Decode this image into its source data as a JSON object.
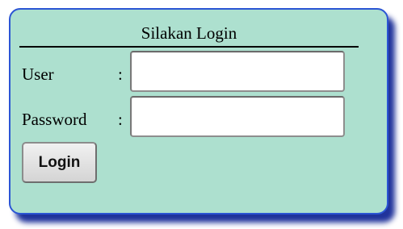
{
  "form": {
    "title": "Silakan Login",
    "user_label": "User",
    "user_separator": ":",
    "user_value": "",
    "password_label": "Password",
    "password_separator": ":",
    "password_value": "",
    "submit_label": "Login"
  },
  "colors": {
    "panel_background": "#ade0cf",
    "panel_border": "#2b55d4",
    "panel_shadow": "#1428a0"
  }
}
